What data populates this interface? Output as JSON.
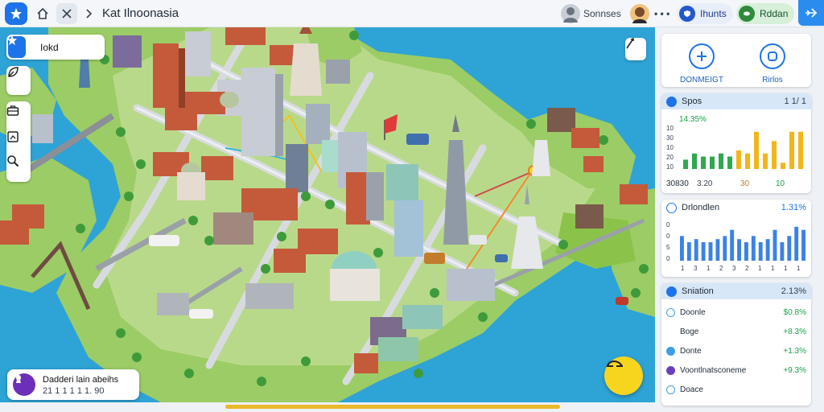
{
  "app": {
    "title": "Kat Ilnoonasia"
  },
  "topbar": {
    "user1_name": "Sonnses",
    "user2_dots": "• • •",
    "pill1_label": "Ihunts",
    "pill2_label": "Rddan"
  },
  "map": {
    "search_value": "Iokd",
    "info_card": {
      "line1": "Dadderi lain abeihs",
      "line2": "21 1 1 1 1 1. 90"
    }
  },
  "panel": {
    "actions": [
      {
        "label": "DONMEIGT",
        "icon": "target-icon"
      },
      {
        "label": "Rirlos",
        "icon": "square-icon"
      }
    ],
    "card1": {
      "title": "Spos",
      "right": "1 1/ 1",
      "value_top": "14.35%",
      "footer": [
        "30830",
        "3.20",
        "30",
        "10"
      ]
    },
    "card2": {
      "title": "Drlondlen",
      "right": "1.31%"
    },
    "card3": {
      "title": "Sniation",
      "right": "2.13%",
      "rows": [
        {
          "label": "Doonle",
          "value": "$0.8%",
          "color": "#4aa3e8"
        },
        {
          "label": "Boge",
          "value": "+8.3%",
          "color": "#ffffff"
        },
        {
          "label": "Donte",
          "value": "+1.3%",
          "color": "#3ba0e8"
        },
        {
          "label": "Voontlnatsconeme",
          "value": "+9.3%",
          "color": "#6b3fc0"
        },
        {
          "label": "Doace",
          "value": "",
          "color": "#3ba0e8"
        }
      ]
    }
  },
  "chart_data": [
    {
      "type": "bar",
      "series": [
        {
          "color": "#2fa84f",
          "values": [
            3,
            5,
            4,
            4,
            5,
            4,
            5,
            4,
            3
          ]
        },
        {
          "color": "#f2b51c",
          "values": [
            0,
            0,
            0,
            0,
            0,
            0,
            6,
            5,
            12,
            5,
            9,
            2,
            12,
            12
          ]
        }
      ],
      "y_ticks": [
        "10",
        "30",
        "10",
        "20",
        "10"
      ],
      "ylim": [
        0,
        14
      ]
    },
    {
      "type": "bar",
      "values": [
        8,
        6,
        7,
        6,
        6,
        7,
        8,
        10,
        7,
        6,
        8,
        6,
        7,
        10,
        6,
        8,
        11,
        10
      ],
      "x_ticks": [
        "1",
        "3",
        "1",
        "2",
        "3",
        "2",
        "1",
        "1",
        "1",
        "1"
      ],
      "y_ticks": [
        "0",
        "0",
        "5",
        "0"
      ],
      "ylim": [
        0,
        12
      ],
      "color": "#3b82e6"
    }
  ]
}
